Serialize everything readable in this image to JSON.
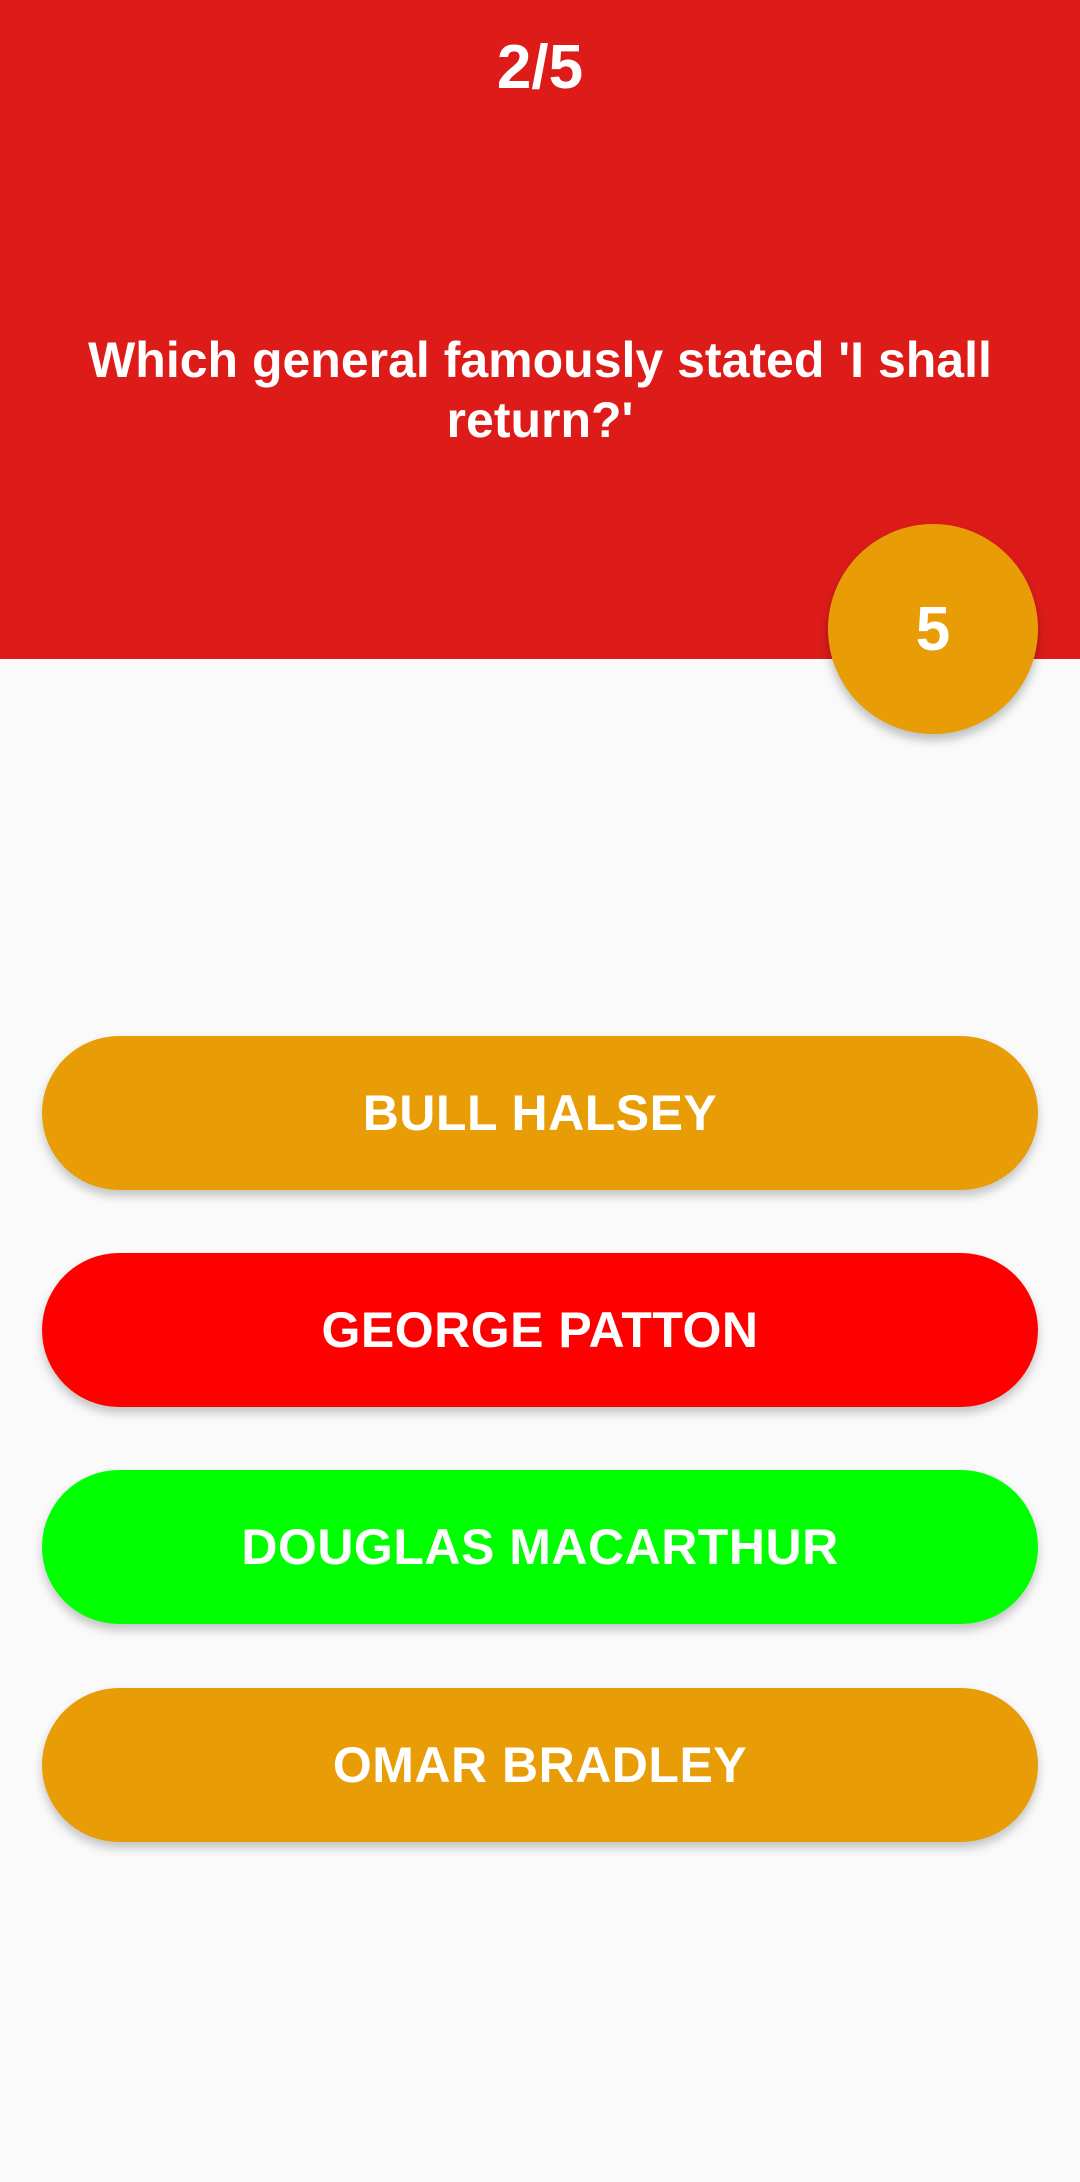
{
  "header": {
    "progress": "2/5",
    "question": "Which general famously stated 'I shall return?'",
    "color": "#dd1c1a"
  },
  "timer": {
    "value": "5",
    "color": "#e89c06"
  },
  "answers": [
    {
      "label": "BULL HALSEY",
      "color": "#e89c06",
      "state": "neutral"
    },
    {
      "label": "GEORGE PATTON",
      "color": "#ff0000",
      "state": "wrong"
    },
    {
      "label": "DOUGLAS MACARTHUR",
      "color": "#00ff00",
      "state": "correct"
    },
    {
      "label": "OMAR BRADLEY",
      "color": "#e89c06",
      "state": "neutral"
    }
  ]
}
